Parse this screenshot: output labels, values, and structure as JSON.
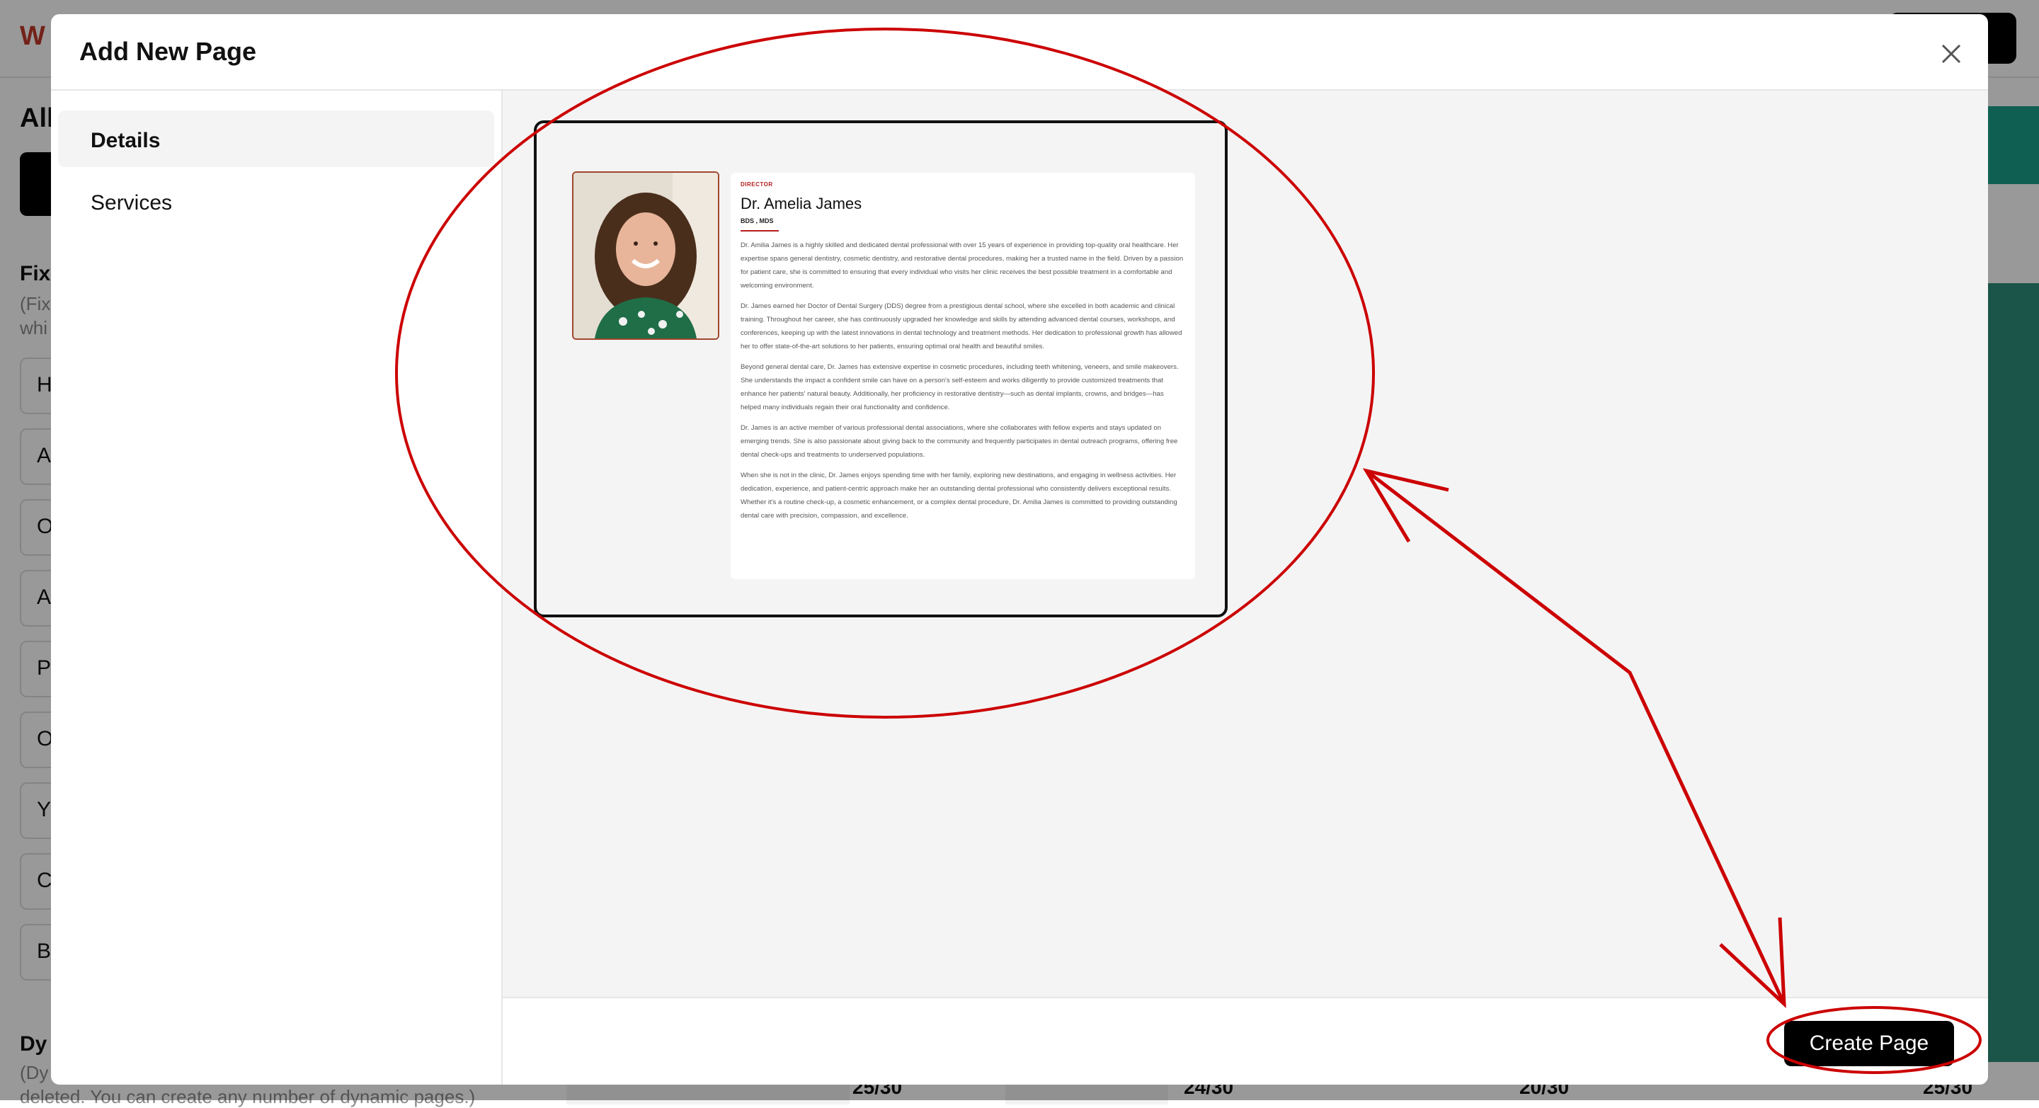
{
  "background": {
    "logo": "W",
    "heading": "All",
    "fixed_title": "Fix",
    "fixed_sub_1": "(Fix",
    "fixed_sub_2": "whi",
    "fixed_items": [
      "H",
      "A",
      "O",
      "A",
      "P",
      "O",
      "Y",
      "C",
      "B"
    ],
    "dynamic_title": "Dy",
    "dynamic_sub_1": "(Dy",
    "dynamic_sub_2": "deleted. You can create any number of dynamic pages.)",
    "counts": [
      "25/30",
      "24/30",
      "20/30",
      "25/30"
    ]
  },
  "modal": {
    "title": "Add New Page",
    "sidebar": [
      {
        "label": "Details",
        "active": true
      },
      {
        "label": "Services",
        "active": false
      }
    ],
    "create_button": "Create Page"
  },
  "template": {
    "role": "DIRECTOR",
    "name": "Dr. Amelia James",
    "degrees": "BDS , MDS",
    "paragraphs": [
      "Dr. Amilia James is a highly skilled and dedicated dental professional with over 15 years of experience in providing top-quality oral healthcare. Her expertise spans general dentistry, cosmetic dentistry, and restorative dental procedures, making her a trusted name in the field. Driven by a passion for patient care, she is committed to ensuring that every individual who visits her clinic receives the best possible treatment in a comfortable and welcoming environment.",
      "Dr. James earned her Doctor of Dental Surgery (DDS) degree from a prestigious dental school, where she excelled in both academic and clinical training. Throughout her career, she has continuously upgraded her knowledge and skills by attending advanced dental courses, workshops, and conferences, keeping up with the latest innovations in dental technology and treatment methods. Her dedication to professional growth has allowed her to offer state-of-the-art solutions to her patients, ensuring optimal oral health and beautiful smiles.",
      "Beyond general dental care, Dr. James has extensive expertise in cosmetic procedures, including teeth whitening, veneers, and smile makeovers. She understands the impact a confident smile can have on a person's self-esteem and works diligently to provide customized treatments that enhance her patients' natural beauty. Additionally, her proficiency in restorative dentistry—such as dental implants, crowns, and bridges—has helped many individuals regain their oral functionality and confidence.",
      "Dr. James is an active member of various professional dental associations, where she collaborates with fellow experts and stays updated on emerging trends. She is also passionate about giving back to the community and frequently participates in dental outreach programs, offering free dental check-ups and treatments to underserved populations.",
      "When she is not in the clinic, Dr. James enjoys spending time with her family, exploring new destinations, and engaging in wellness activities. Her dedication, experience, and patient-centric approach make her an outstanding dental professional who consistently delivers exceptional results. Whether it's a routine check-up, a cosmetic enhancement, or a complex dental procedure, Dr. Amilia James is committed to providing outstanding dental care with precision, compassion, and excellence."
    ]
  },
  "colors": {
    "accent": "#b71c1c",
    "annotation": "#cc0000",
    "button": "#000000",
    "preview_bg": "#f4f4f4"
  },
  "icons": {
    "close": "close-icon"
  }
}
